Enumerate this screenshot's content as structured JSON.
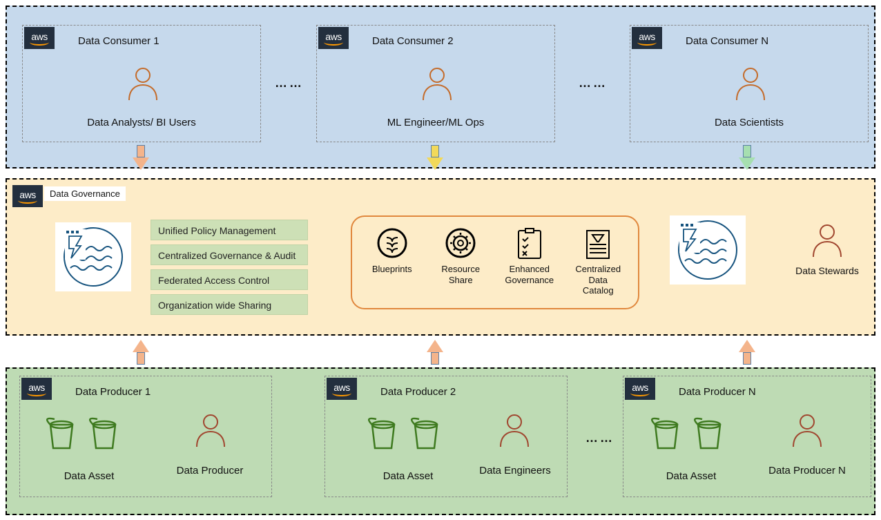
{
  "layers": {
    "consumers": {
      "cards": [
        {
          "title": "Data Consumer 1",
          "role": "Data Analysts/ BI Users"
        },
        {
          "title": "Data Consumer 2",
          "role": "ML Engineer/ML Ops"
        },
        {
          "title": "Data Consumer N",
          "role": "Data Scientists"
        }
      ]
    },
    "arrows_top_to_mid": [
      {
        "color": "#f4b48b"
      },
      {
        "color": "#f2d95a"
      },
      {
        "color": "#a6dfb0"
      }
    ],
    "governance": {
      "title": "Data Governance",
      "policies": [
        "Unified Policy Management",
        "Centralized  Governance & Audit",
        "Federated Access Control",
        "Organization wide Sharing"
      ],
      "center_items": [
        {
          "icon": "blueprints-icon",
          "label": "Blueprints"
        },
        {
          "icon": "resource-share-icon",
          "label": "Resource Share"
        },
        {
          "icon": "enhanced-governance-icon",
          "label": "Enhanced\nGovernance"
        },
        {
          "icon": "centralized-catalog-icon",
          "label": "Centralized\nData\nCatalog"
        }
      ],
      "steward_label": "Data Stewards"
    },
    "arrows_bot_to_mid": [
      {
        "color": "#f4b48b"
      },
      {
        "color": "#f4b48b"
      },
      {
        "color": "#f4b48b"
      }
    ],
    "producers": {
      "cards": [
        {
          "title": "Data Producer 1",
          "asset_label": "Data Asset",
          "role": "Data Producer"
        },
        {
          "title": "Data Producer 2",
          "asset_label": "Data Asset",
          "role": "Data Engineers"
        },
        {
          "title": "Data Producer N",
          "asset_label": "Data Asset",
          "role": "Data Producer N"
        }
      ]
    },
    "ellipsis": "……"
  },
  "icons": {
    "person": "person-icon",
    "bucket": "bucket-icon",
    "lake": "lake-formation-icon"
  }
}
